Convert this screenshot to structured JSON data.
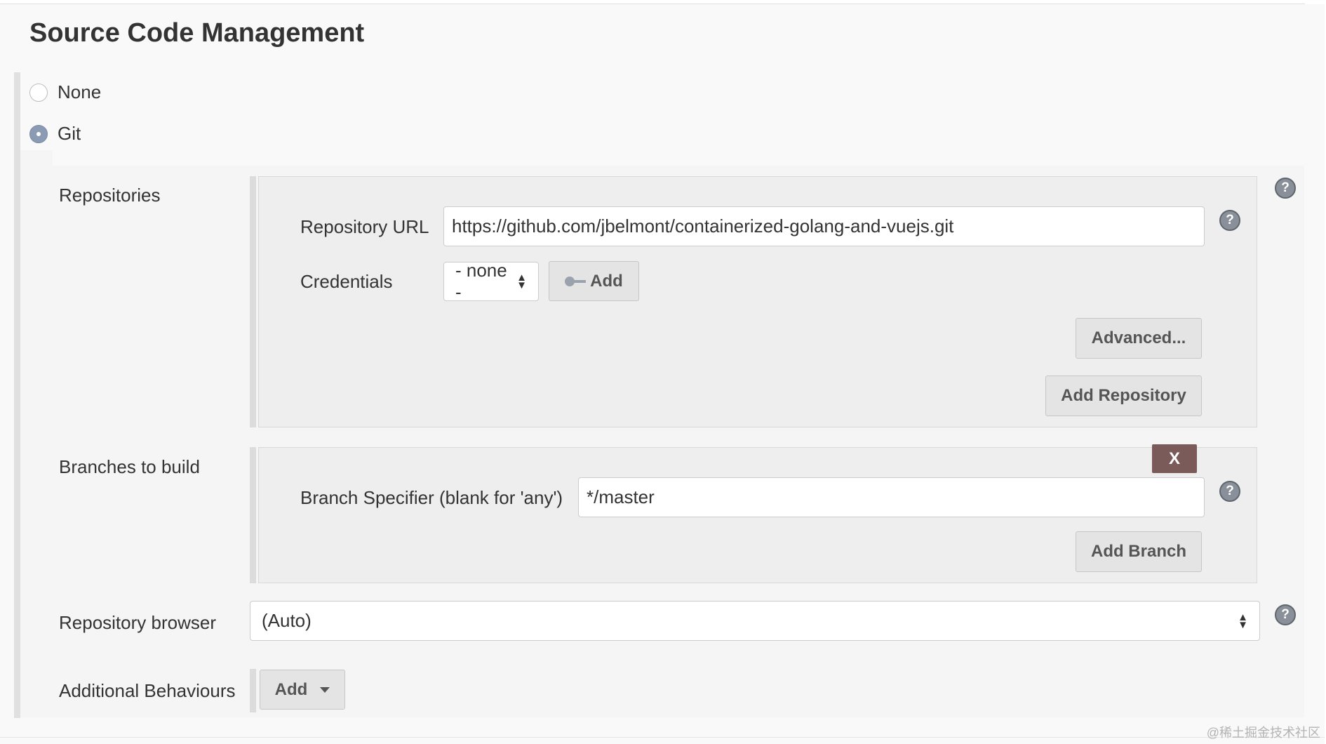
{
  "section": {
    "title": "Source Code Management"
  },
  "scm_options": {
    "none_label": "None",
    "git_label": "Git",
    "selected": "Git"
  },
  "repositories": {
    "label": "Repositories",
    "url_label": "Repository URL",
    "url_value": "https://github.com/jbelmont/containerized-golang-and-vuejs.git",
    "credentials_label": "Credentials",
    "credentials_value": "- none -",
    "add_credentials_label": "Add",
    "advanced_label": "Advanced...",
    "add_repository_label": "Add Repository"
  },
  "branches": {
    "label": "Branches to build",
    "delete_label": "X",
    "specifier_label": "Branch Specifier (blank for 'any')",
    "specifier_value": "*/master",
    "add_branch_label": "Add Branch"
  },
  "repo_browser": {
    "label": "Repository browser",
    "value": "(Auto)"
  },
  "additional_behaviours": {
    "label": "Additional Behaviours",
    "add_label": "Add"
  },
  "help": {
    "glyph": "?"
  },
  "icons": {
    "help": "help-icon",
    "key": "key-icon",
    "dropdown": "caret-down-icon",
    "select_arrows": "select-arrows-icon"
  },
  "colors": {
    "delete_button": "#7b5a5a",
    "help_icon": "#8a9099",
    "radio_checked": "#8a9bb3"
  },
  "watermark": "@稀土掘金技术社区"
}
